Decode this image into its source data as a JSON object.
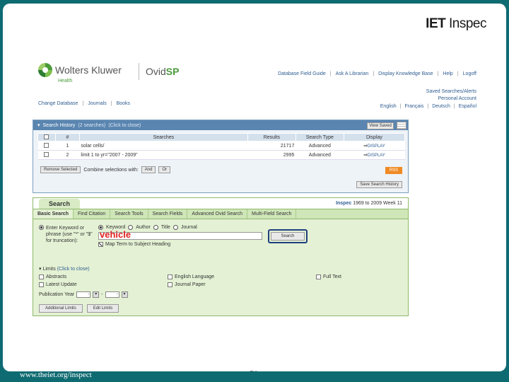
{
  "slide": {
    "brand_iet": "IET",
    "brand_inspec": "Inspec",
    "footer_url": "www.theiet.org/inspect",
    "page_number": "70"
  },
  "header": {
    "wk_logo": "Wolters Kluwer",
    "wk_sub": "Health",
    "product_prefix": "Ovid",
    "product_suffix": "SP",
    "top_links": [
      "Database Field Guide",
      "Ask A Librarian",
      "Display Knowledge Base",
      "Help",
      "Logoff"
    ],
    "saved_searches": "Saved Searches/Alerts",
    "personal_account": "Personal Account",
    "languages": [
      "English",
      "Français",
      "Deutsch",
      "Español"
    ],
    "left_links": [
      "Change Database",
      "Journals",
      "Books"
    ]
  },
  "history": {
    "title": "Search History",
    "count": "(2 searches)",
    "hint": "(Click to close)",
    "view_saved": "View Saved",
    "columns": [
      "",
      "#",
      "Searches",
      "Results",
      "Search Type",
      "Display"
    ],
    "rows": [
      {
        "num": "1",
        "search": "solar cells/",
        "results": "21717",
        "type": "Advanced",
        "display": "DISPLAY"
      },
      {
        "num": "2",
        "search": "limit 1 to yr=\"2007 - 2009\"",
        "results": "2995",
        "type": "Advanced",
        "display": "DISPLAY"
      }
    ],
    "remove_selected": "Remove Selected",
    "combine_label": "Combine selections with:",
    "and_label": "And",
    "or_label": "Or",
    "rss": "RSS",
    "save_history": "Save Search History"
  },
  "search": {
    "title": "Search",
    "db_name": "Inspec",
    "db_range": "1969 to 2009 Week 11",
    "tabs": [
      "Basic Search",
      "Find Citation",
      "Search Tools",
      "Search Fields",
      "Advanced Ovid Search",
      "Multi-Field Search"
    ],
    "option_text": "Enter Keyword or phrase (use \"*\" or \"$\" for truncation):",
    "field_options": [
      "Keyword",
      "Author",
      "Title",
      "Journal"
    ],
    "query_value": "vehicle",
    "search_button": "Search",
    "map_term": "Map Term to Subject Heading",
    "limits_title": "Limits",
    "limits_hint": "(Click to close)",
    "limits": [
      "Abstracts",
      "English Language",
      "Full Text",
      "Latest Update",
      "Journal Paper"
    ],
    "pub_year_label": "Publication Year",
    "pub_year_sep": "-",
    "additional_limits": "Additional Limits",
    "edit_limits": "Edit Limits"
  }
}
